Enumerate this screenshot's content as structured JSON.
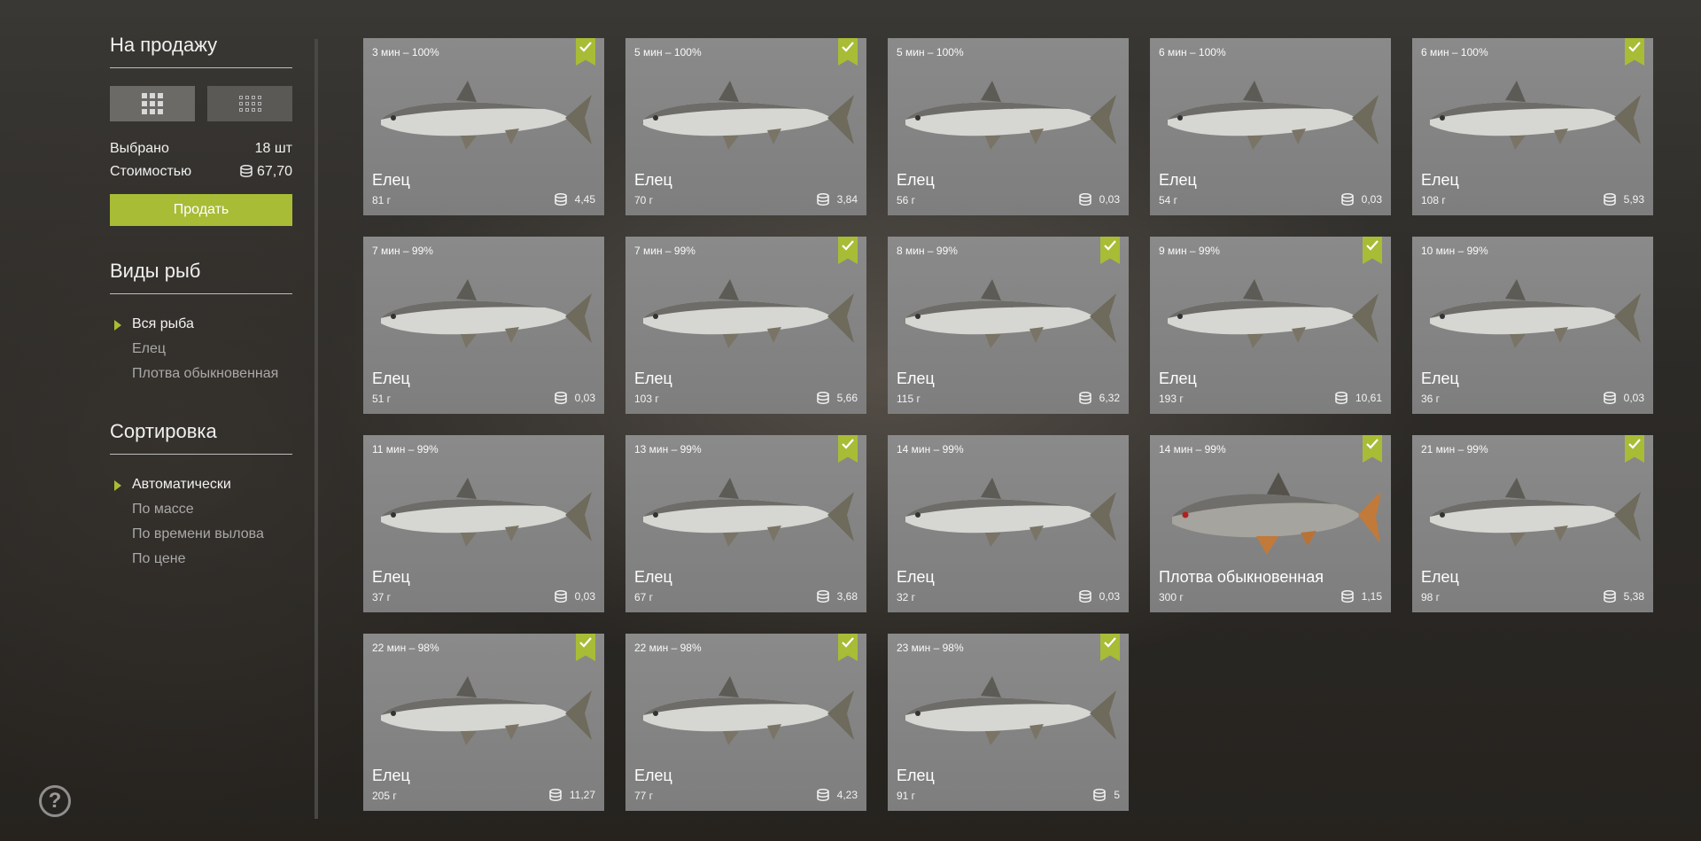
{
  "sidebar": {
    "title": "На продажу",
    "selected_label": "Выбрано",
    "selected_value": "18 шт",
    "cost_label": "Стоимостью",
    "cost_value": "67,70",
    "sell_label": "Продать",
    "species_title": "Виды рыб",
    "species": [
      {
        "label": "Вся рыба",
        "active": true
      },
      {
        "label": "Елец",
        "active": false
      },
      {
        "label": "Плотва обыкновенная",
        "active": false
      }
    ],
    "sort_title": "Сортировка",
    "sort": [
      {
        "label": "Автоматически",
        "active": true
      },
      {
        "label": "По массе",
        "active": false
      },
      {
        "label": "По времени вылова",
        "active": false
      },
      {
        "label": "По цене",
        "active": false
      }
    ]
  },
  "help_label": "?",
  "colors": {
    "accent": "#a8bc36",
    "card_bg": "#858585"
  },
  "fish": [
    {
      "time": "3 мин – 100%",
      "name": "Елец",
      "weight": "81 г",
      "price": "4,45",
      "checked": true,
      "kind": "dace"
    },
    {
      "time": "5 мин – 100%",
      "name": "Елец",
      "weight": "70 г",
      "price": "3,84",
      "checked": true,
      "kind": "dace"
    },
    {
      "time": "5 мин – 100%",
      "name": "Елец",
      "weight": "56 г",
      "price": "0,03",
      "checked": false,
      "kind": "dace"
    },
    {
      "time": "6 мин – 100%",
      "name": "Елец",
      "weight": "54 г",
      "price": "0,03",
      "checked": false,
      "kind": "dace"
    },
    {
      "time": "6 мин – 100%",
      "name": "Елец",
      "weight": "108 г",
      "price": "5,93",
      "checked": true,
      "kind": "dace"
    },
    {
      "time": "7 мин – 99%",
      "name": "Елец",
      "weight": "51 г",
      "price": "0,03",
      "checked": false,
      "kind": "dace"
    },
    {
      "time": "7 мин – 99%",
      "name": "Елец",
      "weight": "103 г",
      "price": "5,66",
      "checked": true,
      "kind": "dace"
    },
    {
      "time": "8 мин – 99%",
      "name": "Елец",
      "weight": "115 г",
      "price": "6,32",
      "checked": true,
      "kind": "dace"
    },
    {
      "time": "9 мин – 99%",
      "name": "Елец",
      "weight": "193 г",
      "price": "10,61",
      "checked": true,
      "kind": "dace"
    },
    {
      "time": "10 мин – 99%",
      "name": "Елец",
      "weight": "36 г",
      "price": "0,03",
      "checked": false,
      "kind": "dace"
    },
    {
      "time": "11 мин – 99%",
      "name": "Елец",
      "weight": "37 г",
      "price": "0,03",
      "checked": false,
      "kind": "dace"
    },
    {
      "time": "13 мин – 99%",
      "name": "Елец",
      "weight": "67 г",
      "price": "3,68",
      "checked": true,
      "kind": "dace"
    },
    {
      "time": "14 мин – 99%",
      "name": "Елец",
      "weight": "32 г",
      "price": "0,03",
      "checked": false,
      "kind": "dace"
    },
    {
      "time": "14 мин – 99%",
      "name": "Плотва обыкновенная",
      "weight": "300 г",
      "price": "1,15",
      "checked": true,
      "kind": "roach"
    },
    {
      "time": "21 мин – 99%",
      "name": "Елец",
      "weight": "98 г",
      "price": "5,38",
      "checked": true,
      "kind": "dace"
    },
    {
      "time": "22 мин – 98%",
      "name": "Елец",
      "weight": "205 г",
      "price": "11,27",
      "checked": true,
      "kind": "dace"
    },
    {
      "time": "22 мин – 98%",
      "name": "Елец",
      "weight": "77 г",
      "price": "4,23",
      "checked": true,
      "kind": "dace"
    },
    {
      "time": "23 мин – 98%",
      "name": "Елец",
      "weight": "91 г",
      "price": "5",
      "checked": true,
      "kind": "dace"
    }
  ]
}
